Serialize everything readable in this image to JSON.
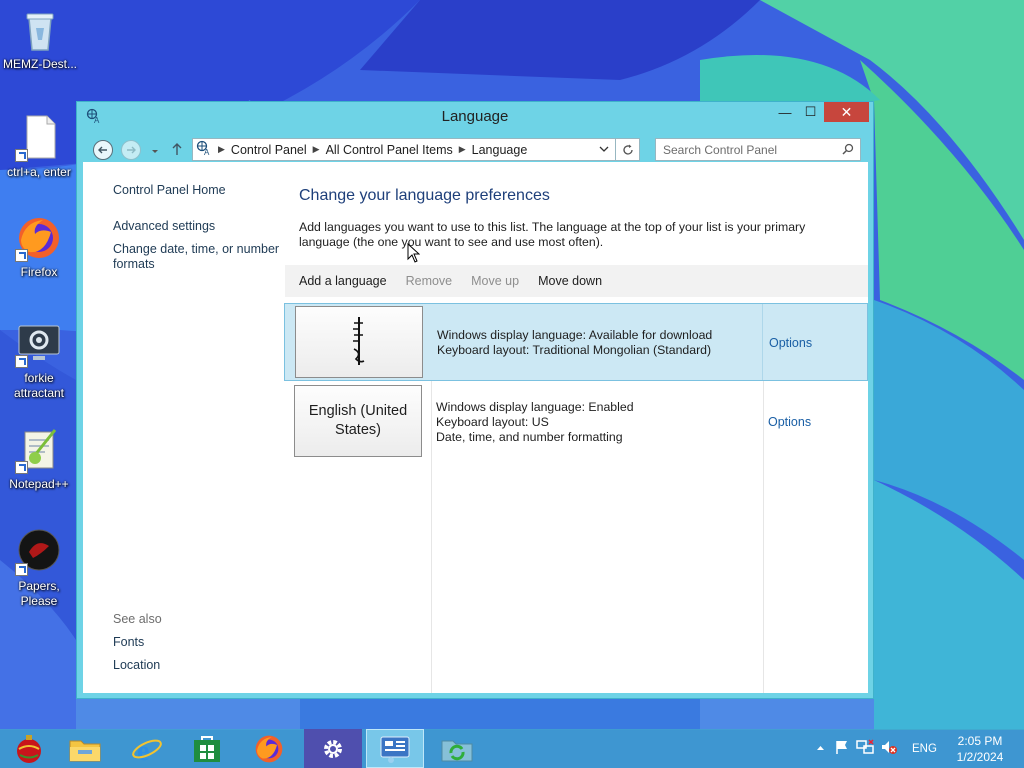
{
  "desktop": {
    "icons": [
      {
        "label": "MEMZ-Dest...",
        "icon": "recycle-bin-icon"
      },
      {
        "label": "ctrl+a, enter",
        "icon": "text-file-icon"
      },
      {
        "label": "Firefox",
        "icon": "firefox-icon"
      },
      {
        "label": "forkie attractant",
        "icon": "settings-monitor-icon"
      },
      {
        "label": "Notepad++",
        "icon": "notepad-plus-plus-icon"
      },
      {
        "label": "Papers, Please",
        "icon": "papers-please-icon"
      }
    ]
  },
  "window": {
    "title": "Language",
    "buttons": {
      "minimize": "—",
      "maximize": "☐",
      "close": "✕"
    },
    "breadcrumb": [
      "Control Panel",
      "All Control Panel Items",
      "Language"
    ],
    "search_placeholder": "Search Control Panel",
    "sidebar": {
      "home": "Control Panel Home",
      "advanced": "Advanced settings",
      "change_formats": "Change date, time, or number formats",
      "see_also": "See also",
      "fonts": "Fonts",
      "location": "Location"
    },
    "heading": "Change your language preferences",
    "description": "Add languages you want to use to this list. The language at the top of your list is your primary language (the one you want to see and use most often).",
    "toolbar": {
      "add": "Add a language",
      "remove": "Remove",
      "move_up": "Move up",
      "move_down": "Move down"
    },
    "languages": [
      {
        "tile": "",
        "tile_script": "ᠮᠣᠩ",
        "line1": "Windows display language: Available for download",
        "line2": "Keyboard layout: Traditional Mongolian (Standard)",
        "line3": "",
        "options": "Options",
        "selected": true
      },
      {
        "tile": "English (United States)",
        "line1": "Windows display language: Enabled",
        "line2": "Keyboard layout: US",
        "line3": "Date, time, and number formatting",
        "options": "Options",
        "selected": false
      }
    ]
  },
  "taskbar": {
    "items": [
      {
        "icon": "start-ornament-icon"
      },
      {
        "icon": "file-explorer-icon"
      },
      {
        "icon": "internet-explorer-icon"
      },
      {
        "icon": "store-icon"
      },
      {
        "icon": "firefox-icon"
      },
      {
        "icon": "settings-gear-icon"
      },
      {
        "icon": "control-panel-icon",
        "active": true
      },
      {
        "icon": "sync-folder-icon"
      }
    ],
    "tray": {
      "language": "ENG",
      "time": "2:05 PM",
      "date": "1/2/2024"
    }
  },
  "colors": {
    "window_frame": "#6ed3e6",
    "close_button": "#c7463d",
    "link": "#1a5fa5",
    "heading": "#1e3f7a",
    "selected_row": "#cce8f4"
  }
}
